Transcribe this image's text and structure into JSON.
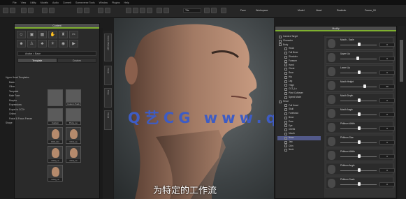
{
  "menu": [
    "File",
    "View",
    "Utility",
    "Models",
    "Audio",
    "Commit",
    "Sceneverse Tools",
    "Window",
    "Plugins",
    "Help"
  ],
  "toolbar": {
    "face_label": "Face",
    "workspace_label": "Workspace",
    "model_label": "Model",
    "head_label": "Head",
    "realistic_label": "Realistic",
    "frame_label": "Frame_00",
    "view_label": "Tile"
  },
  "left_panel": {
    "title": "Content",
    "icons": [
      "person-icon",
      "cube-icon",
      "grid-icon",
      "hand-icon",
      "shirt-icon",
      "hair-icon",
      "face-icon",
      "body-icon",
      "tree-icon",
      "light-icon",
      "camera-icon",
      "film-icon"
    ],
    "breadcrumb": "Avatar > Base",
    "tabs": [
      "Template",
      "Custom"
    ],
    "tree": [
      "Upper Head Templates",
      "Basic",
      "Other",
      "Template",
      "Male Face",
      "Morphs",
      "Expressions",
      "Export to CC3+",
      "Online",
      "Facial & Focus Freeze",
      "Shape"
    ],
    "thumbs": [
      {
        "label": "",
        "kind": "folder"
      },
      {
        "label": "Custom Pack",
        "kind": "folder"
      },
      {
        "label": "Custom",
        "kind": "folder"
      },
      {
        "label": "Pony_Lo",
        "kind": "folder"
      },
      {
        "label": "CC3_Fm",
        "kind": "head"
      },
      {
        "label": "CC3_Lo",
        "kind": "head"
      },
      {
        "label": "CC3_Lo",
        "kind": "head"
      },
      {
        "label": "CC3_Lo",
        "kind": "head"
      },
      {
        "label": "CC3_Lo",
        "kind": "head"
      }
    ]
  },
  "vertical_tabs": [
    "Scene Manager",
    "Visual",
    "Pose",
    "Visual"
  ],
  "right_panel": {
    "title": "Modify",
    "scene": [
      {
        "label": "Camera Target",
        "selected": false
      },
      {
        "label": "Character",
        "selected": false
      },
      {
        "label": "Body",
        "selected": false
      },
      {
        "label": "Head",
        "selected": false
      },
      {
        "label": "Full Brow",
        "selected": false
      },
      {
        "label": "Shoulder",
        "selected": false
      },
      {
        "label": "Forearm",
        "selected": false
      },
      {
        "label": "Hand",
        "selected": false
      },
      {
        "label": "Chest",
        "selected": false
      },
      {
        "label": "Rear",
        "selected": false
      },
      {
        "label": "Hip",
        "selected": false
      },
      {
        "label": "Leg",
        "selected": false
      },
      {
        "label": "Thigh",
        "selected": false
      },
      {
        "label": "CC3_Lo",
        "selected": false
      },
      {
        "label": "Pivot Cuttower",
        "selected": false
      },
      {
        "label": "Speed Mode",
        "selected": false
      },
      {
        "label": "Head",
        "selected": false
      },
      {
        "label": "Full Head",
        "selected": false
      },
      {
        "label": "Skull",
        "selected": false
      },
      {
        "label": "Forehead",
        "selected": false
      },
      {
        "label": "Brow",
        "selected": false
      },
      {
        "label": "Ears",
        "selected": false
      },
      {
        "label": "Eye",
        "selected": false
      },
      {
        "label": "Cheek",
        "selected": false
      },
      {
        "label": "Mouth",
        "selected": false
      },
      {
        "label": "Nose",
        "selected": true
      },
      {
        "label": "Jaw",
        "selected": false
      },
      {
        "label": "Chin",
        "selected": false
      },
      {
        "label": "Neck",
        "selected": false
      }
    ],
    "morphs": [
      {
        "name": "Mouth - Scale",
        "value": "0",
        "pos": 0.5
      },
      {
        "name": "Upper Lip",
        "value": "0",
        "pos": 0.45
      },
      {
        "name": "Lower Lip",
        "value": "0",
        "pos": 0.5
      },
      {
        "name": "Mouth Height",
        "value": "30",
        "pos": 0.65
      },
      {
        "name": "Mouth Depth",
        "value": "0",
        "pos": 0.5
      },
      {
        "name": "Mouth Angle",
        "value": "0",
        "pos": 0.5
      },
      {
        "name": "Philtrum Width",
        "value": "0",
        "pos": 0.5
      },
      {
        "name": "Philtrum Size",
        "value": "0",
        "pos": 0.5
      },
      {
        "name": "Philtrum Width",
        "value": "0",
        "pos": 0.5
      },
      {
        "name": "Philtrum Angle",
        "value": "0",
        "pos": 0.5
      },
      {
        "name": "Philtrum Scale",
        "value": "0",
        "pos": 0.5
      }
    ]
  },
  "overlay": {
    "watermark": "Q艺CG www.qdnxxrb.cn",
    "subtitle": "为特定的工作流"
  }
}
